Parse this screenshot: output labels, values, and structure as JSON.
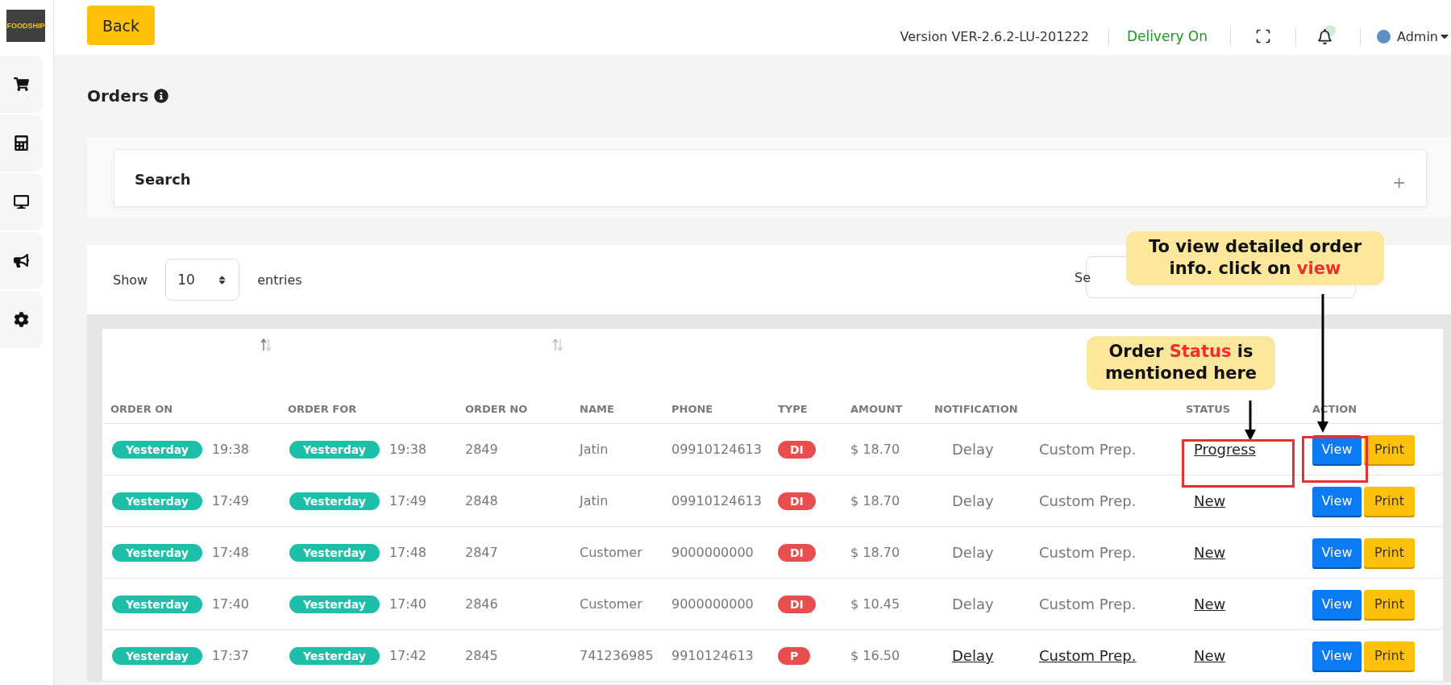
{
  "logo_text": "FOODSHIP",
  "back_button": "Back",
  "topbar": {
    "version": "Version VER-2.6.2-LU-201222",
    "delivery_status": "Delivery On",
    "user": "Admin"
  },
  "page_title": "Orders",
  "search_panel": {
    "title": "Search",
    "expand": "+"
  },
  "entries": {
    "show_label": "Show",
    "value": "10",
    "entries_label": "entries",
    "search_label": "Se"
  },
  "table": {
    "columns": [
      "ORDER ON",
      "ORDER FOR",
      "ORDER NO",
      "NAME",
      "PHONE",
      "TYPE",
      "AMOUNT",
      "NOTIFICATION",
      "STATUS",
      "ACTION"
    ],
    "rows": [
      {
        "order_on_day": "Yesterday",
        "order_on_time": "19:38",
        "order_for_day": "Yesterday",
        "order_for_time": "19:38",
        "order_no": "2849",
        "name": "Jatin",
        "phone": "09910124613",
        "type": "DI",
        "amount": "$ 18.70",
        "notification": "Delay",
        "prep": "Custom Prep.",
        "notification_link": false,
        "status": "Progress",
        "view": "View",
        "print": "Print"
      },
      {
        "order_on_day": "Yesterday",
        "order_on_time": "17:49",
        "order_for_day": "Yesterday",
        "order_for_time": "17:49",
        "order_no": "2848",
        "name": "Jatin",
        "phone": "09910124613",
        "type": "DI",
        "amount": "$ 18.70",
        "notification": "Delay",
        "prep": "Custom Prep.",
        "notification_link": false,
        "status": "New",
        "view": "View",
        "print": "Print"
      },
      {
        "order_on_day": "Yesterday",
        "order_on_time": "17:48",
        "order_for_day": "Yesterday",
        "order_for_time": "17:48",
        "order_no": "2847",
        "name": "Customer",
        "phone": "9000000000",
        "type": "DI",
        "amount": "$ 18.70",
        "notification": "Delay",
        "prep": "Custom Prep.",
        "notification_link": false,
        "status": "New",
        "view": "View",
        "print": "Print"
      },
      {
        "order_on_day": "Yesterday",
        "order_on_time": "17:40",
        "order_for_day": "Yesterday",
        "order_for_time": "17:40",
        "order_no": "2846",
        "name": "Customer",
        "phone": "9000000000",
        "type": "DI",
        "amount": "$ 10.45",
        "notification": "Delay",
        "prep": "Custom Prep.",
        "notification_link": false,
        "status": "New",
        "view": "View",
        "print": "Print"
      },
      {
        "order_on_day": "Yesterday",
        "order_on_time": "17:37",
        "order_for_day": "Yesterday",
        "order_for_time": "17:42",
        "order_no": "2845",
        "name": "741236985",
        "phone": "9910124613",
        "type": "P",
        "amount": "$ 16.50",
        "notification": "Delay",
        "prep": "Custom Prep.",
        "notification_link": true,
        "status": "New",
        "view": "View",
        "print": "Print"
      }
    ]
  },
  "callouts": [
    {
      "before": "To view detailed order info. click on ",
      "highlight": "view"
    },
    {
      "before": "Order ",
      "highlight": "Status",
      "after": " is mentioned here"
    }
  ]
}
